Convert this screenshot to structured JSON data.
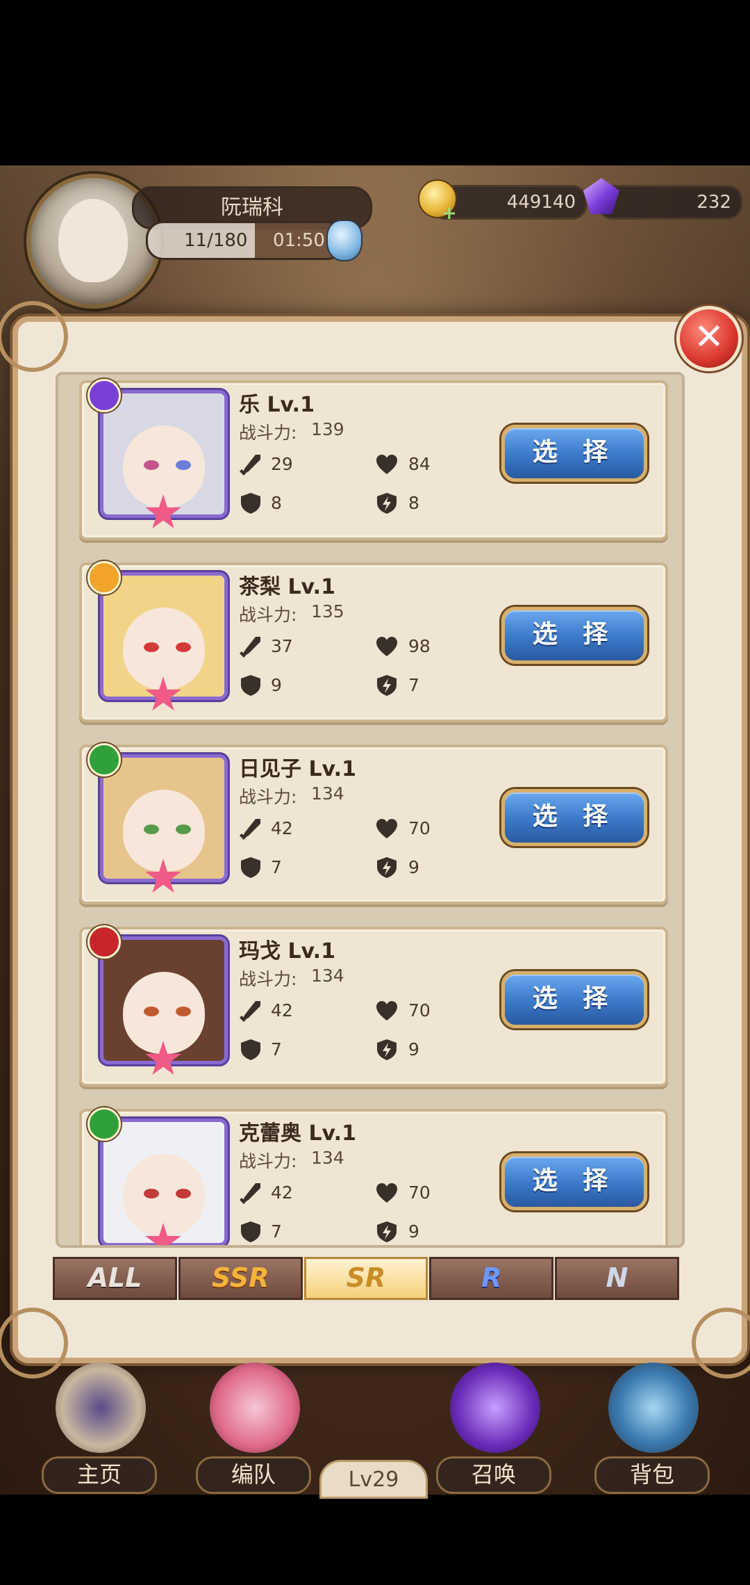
{
  "player": {
    "name": "阮瑞科",
    "stamina": "11/180",
    "timer": "01:50",
    "gold": "449140",
    "gems": "232",
    "level": "Lv29"
  },
  "heroes": [
    {
      "name": "乐 Lv.1",
      "power_label": "战斗力:",
      "power": "139",
      "atk": "29",
      "hp": "84",
      "def": "8",
      "spd": "8",
      "element": "moon-icon",
      "element_color": "#7b3fd6",
      "hair": "#d7d8e4",
      "eyes": [
        "#c4548c",
        "#6a7ed8"
      ]
    },
    {
      "name": "茶梨 Lv.1",
      "power_label": "战斗力:",
      "power": "135",
      "atk": "37",
      "hp": "98",
      "def": "9",
      "spd": "7",
      "element": "light-icon",
      "element_color": "#f0a42a",
      "hair": "#f2d488",
      "eyes": [
        "#d23a3a",
        "#d23a3a"
      ]
    },
    {
      "name": "日见子 Lv.1",
      "power_label": "战斗力:",
      "power": "134",
      "atk": "42",
      "hp": "70",
      "def": "7",
      "spd": "9",
      "element": "wind-icon",
      "element_color": "#2fa03a",
      "hair": "#e7c48c",
      "eyes": [
        "#5a9a4a",
        "#5a9a4a"
      ]
    },
    {
      "name": "玛戈 Lv.1",
      "power_label": "战斗力:",
      "power": "134",
      "atk": "42",
      "hp": "70",
      "def": "7",
      "spd": "9",
      "element": "fire-icon",
      "element_color": "#c8262a",
      "hair": "#6a4030",
      "eyes": [
        "#c05a30",
        "#c05a30"
      ]
    },
    {
      "name": "克蕾奥 Lv.1",
      "power_label": "战斗力:",
      "power": "134",
      "atk": "42",
      "hp": "70",
      "def": "7",
      "spd": "9",
      "element": "wind-icon",
      "element_color": "#2fa03a",
      "hair": "#eef0f4",
      "eyes": [
        "#c23a3a",
        "#c23a3a"
      ]
    }
  ],
  "select_label": "选 择",
  "tabs": [
    "ALL",
    "SSR",
    "SR",
    "R",
    "N"
  ],
  "active_tab": "SR",
  "nav": [
    "主页",
    "编队",
    "召唤",
    "背包"
  ],
  "colors": {
    "accent": "#3a78c8",
    "frame": "#caa57a"
  }
}
